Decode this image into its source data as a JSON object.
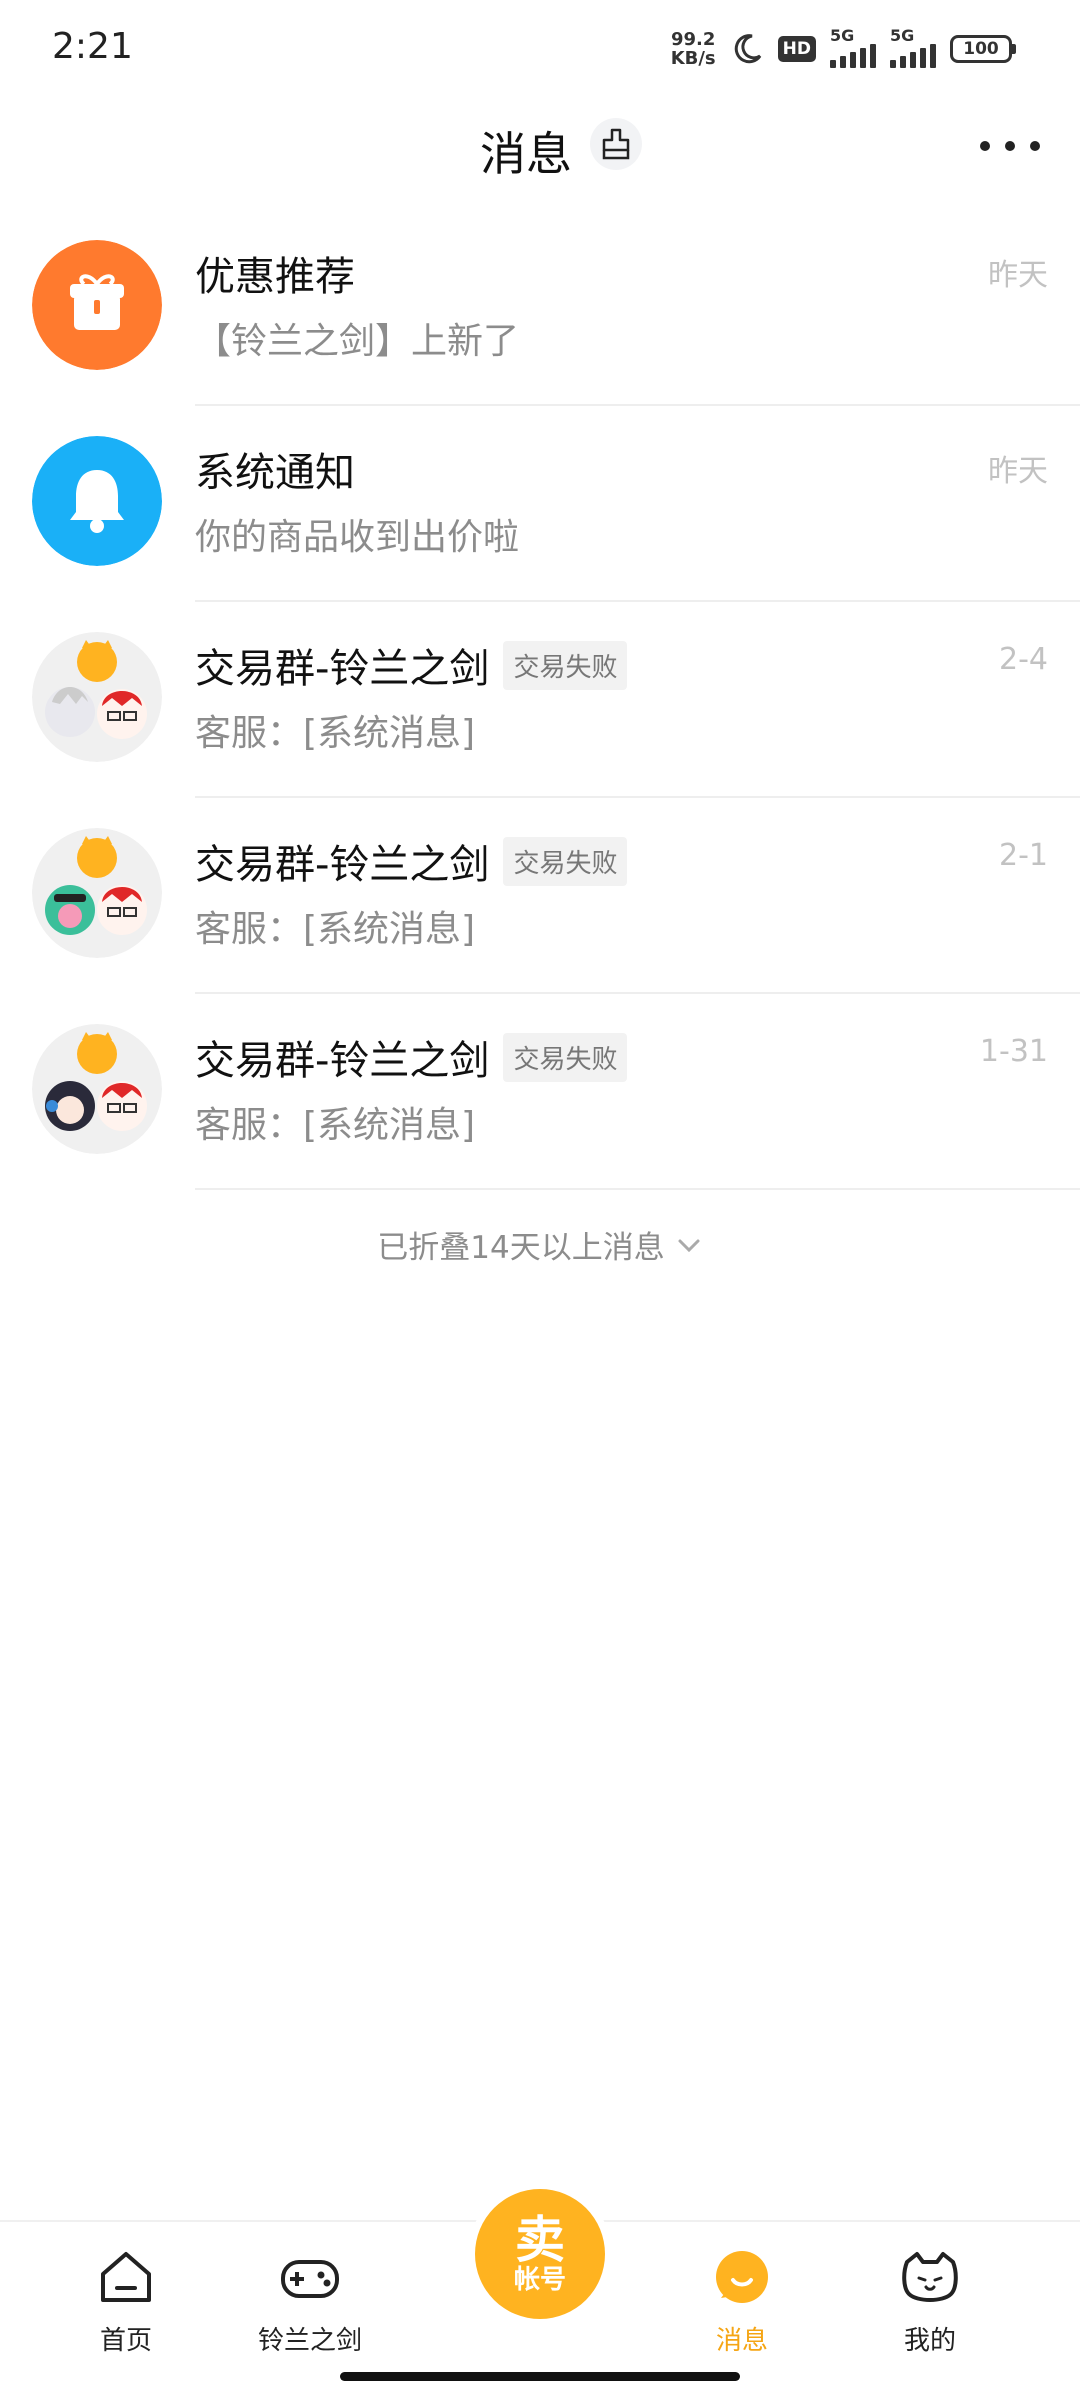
{
  "status_bar": {
    "time": "2:21",
    "net_speed_value": "99.2",
    "net_speed_unit": "KB/s",
    "hd_label": "HD",
    "sim1_label": "5G",
    "sim2_label": "5G",
    "battery": "100"
  },
  "header": {
    "title": "消息",
    "broom_icon": "broom-icon",
    "more_icon": "more-dots-icon"
  },
  "messages": [
    {
      "title": "优惠推荐",
      "subtitle": "【铃兰之剑】上新了",
      "time": "昨天",
      "tag": "",
      "avatar": "gift-icon",
      "avatar_color": "#ff7a2e"
    },
    {
      "title": "系统通知",
      "subtitle": "你的商品收到出价啦",
      "time": "昨天",
      "tag": "",
      "avatar": "bell-icon",
      "avatar_color": "#1ab0f7"
    },
    {
      "title": "交易群-铃兰之剑",
      "subtitle": "客服：[系统消息]",
      "time": "2-4",
      "tag": "交易失败",
      "avatar": "group-avatar"
    },
    {
      "title": "交易群-铃兰之剑",
      "subtitle": "客服：[系统消息]",
      "time": "2-1",
      "tag": "交易失败",
      "avatar": "group-avatar"
    },
    {
      "title": "交易群-铃兰之剑",
      "subtitle": "客服：[系统消息]",
      "time": "1-31",
      "tag": "交易失败",
      "avatar": "group-avatar"
    }
  ],
  "folded_text": "已折叠14天以上消息",
  "tabbar": {
    "tabs": [
      {
        "label": "首页",
        "icon": "home-icon"
      },
      {
        "label": "铃兰之剑",
        "icon": "gamepad-icon"
      },
      {
        "label": "消息",
        "icon": "message-icon",
        "active": true
      },
      {
        "label": "我的",
        "icon": "cat-face-icon"
      }
    ],
    "sell_main": "卖",
    "sell_sub": "帐号"
  },
  "colors": {
    "accent": "#ffb320",
    "active_tab": "#f5a514",
    "gift_bg": "#ff7a2e",
    "bell_bg": "#1ab0f7"
  }
}
